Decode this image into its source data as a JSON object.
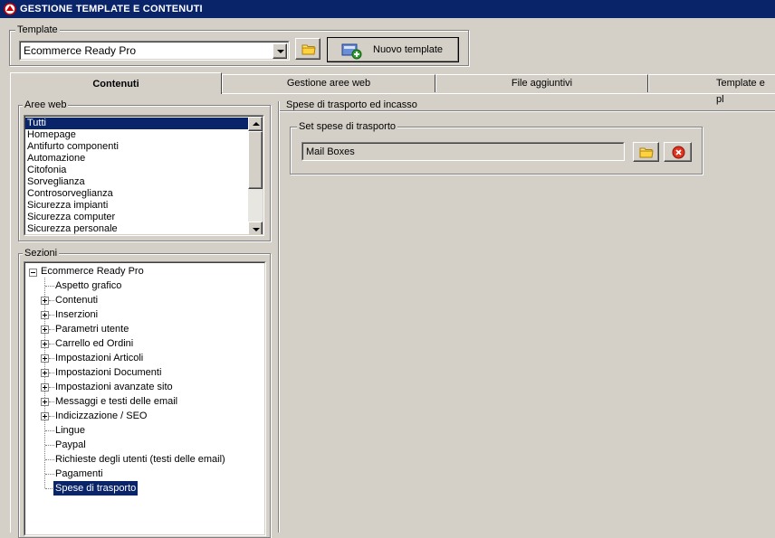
{
  "window": {
    "title": "GESTIONE TEMPLATE E CONTENUTI",
    "icon": "app-logo-icon"
  },
  "template_group": {
    "label": "Template",
    "combo_value": "Ecommerce Ready Pro",
    "browse_icon": "folder-icon",
    "new_button_label": "Nuovo template",
    "new_button_icon": "new-template-icon"
  },
  "tabs": [
    {
      "label": "Contenuti",
      "active": true
    },
    {
      "label": "Gestione aree web",
      "active": false
    },
    {
      "label": "File aggiuntivi",
      "active": false
    },
    {
      "label": "Template e pl",
      "active": false
    }
  ],
  "aree_web": {
    "label": "Aree web",
    "items": [
      "Tutti",
      "Homepage",
      "Antifurto componenti",
      "Automazione",
      "Citofonia",
      "Sorveglianza",
      "Controsorveglianza",
      "Sicurezza impianti",
      "Sicurezza computer",
      "Sicurezza personale"
    ],
    "selected_index": 0
  },
  "sezioni": {
    "label": "Sezioni",
    "root": "Ecommerce Ready Pro",
    "children": [
      {
        "label": "Aspetto grafico",
        "expandable": false
      },
      {
        "label": "Contenuti",
        "expandable": true
      },
      {
        "label": "Inserzioni",
        "expandable": true
      },
      {
        "label": "Parametri utente",
        "expandable": true
      },
      {
        "label": "Carrello ed Ordini",
        "expandable": true
      },
      {
        "label": "Impostazioni Articoli",
        "expandable": true
      },
      {
        "label": "Impostazioni Documenti",
        "expandable": true
      },
      {
        "label": "Impostazioni avanzate sito",
        "expandable": true
      },
      {
        "label": "Messaggi e testi delle email",
        "expandable": true
      },
      {
        "label": "Indicizzazione / SEO",
        "expandable": true
      },
      {
        "label": "Lingue",
        "expandable": false
      },
      {
        "label": "Paypal",
        "expandable": false
      },
      {
        "label": "Richieste degli utenti (testi delle email)",
        "expandable": false
      },
      {
        "label": "Pagamenti",
        "expandable": false
      },
      {
        "label": "Spese di trasporto",
        "expandable": false,
        "selected": true
      }
    ]
  },
  "detail": {
    "outer_label": "Spese di trasporto ed incasso",
    "inner_label": "Set spese di trasporto",
    "value": "Mail Boxes",
    "browse_icon": "folder-icon",
    "clear_icon": "clear-icon"
  }
}
